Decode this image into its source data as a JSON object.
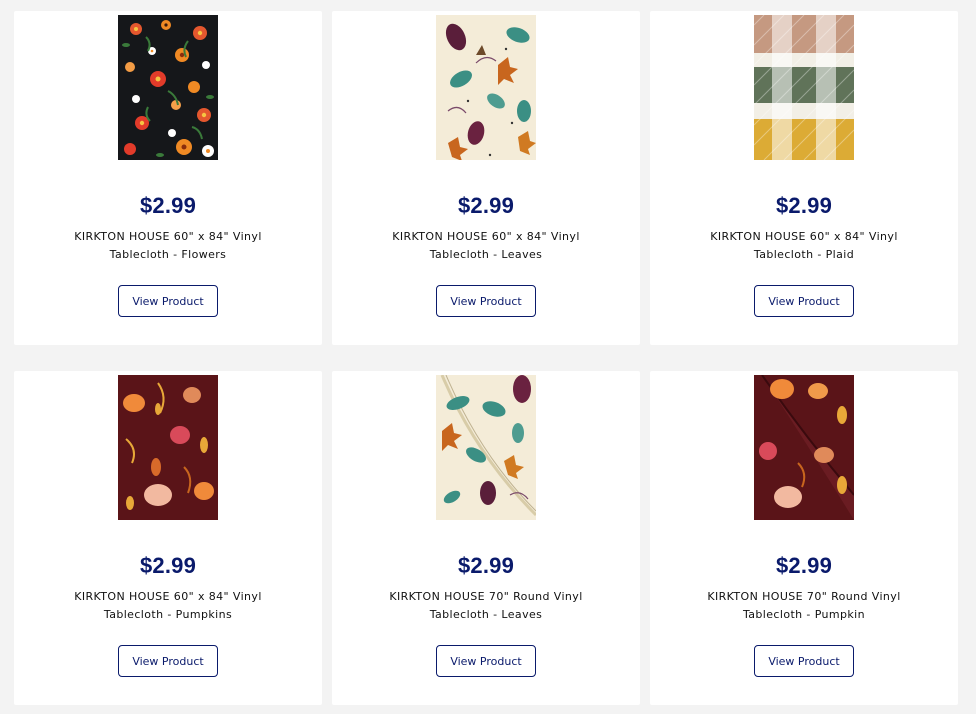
{
  "products": [
    {
      "price": "$2.99",
      "title": "KIRKTON HOUSE 60\" x 84\" Vinyl Tablecloth - Flowers",
      "button": "View Product",
      "image": "tablecloth-flowers-image"
    },
    {
      "price": "$2.99",
      "title": "KIRKTON HOUSE 60\" x 84\" Vinyl Tablecloth - Leaves",
      "button": "View Product",
      "image": "tablecloth-leaves-image"
    },
    {
      "price": "$2.99",
      "title": "KIRKTON HOUSE 60\" x 84\" Vinyl Tablecloth - Plaid",
      "button": "View Product",
      "image": "tablecloth-plaid-image"
    },
    {
      "price": "$2.99",
      "title": "KIRKTON HOUSE 60\" x 84\" Vinyl Tablecloth - Pumpkins",
      "button": "View Product",
      "image": "tablecloth-pumpkins-image"
    },
    {
      "price": "$2.99",
      "title": "KIRKTON HOUSE 70\" Round Vinyl Tablecloth - Leaves",
      "button": "View Product",
      "image": "round-tablecloth-leaves-image"
    },
    {
      "price": "$2.99",
      "title": "KIRKTON HOUSE 70\" Round Vinyl Tablecloth - Pumpkin",
      "button": "View Product",
      "image": "round-tablecloth-pumpkin-image"
    }
  ],
  "colors": {
    "price": "#0a1a6b",
    "button_border": "#0a1a6b",
    "page_bg": "#f3f3f3",
    "card_bg": "#ffffff"
  }
}
